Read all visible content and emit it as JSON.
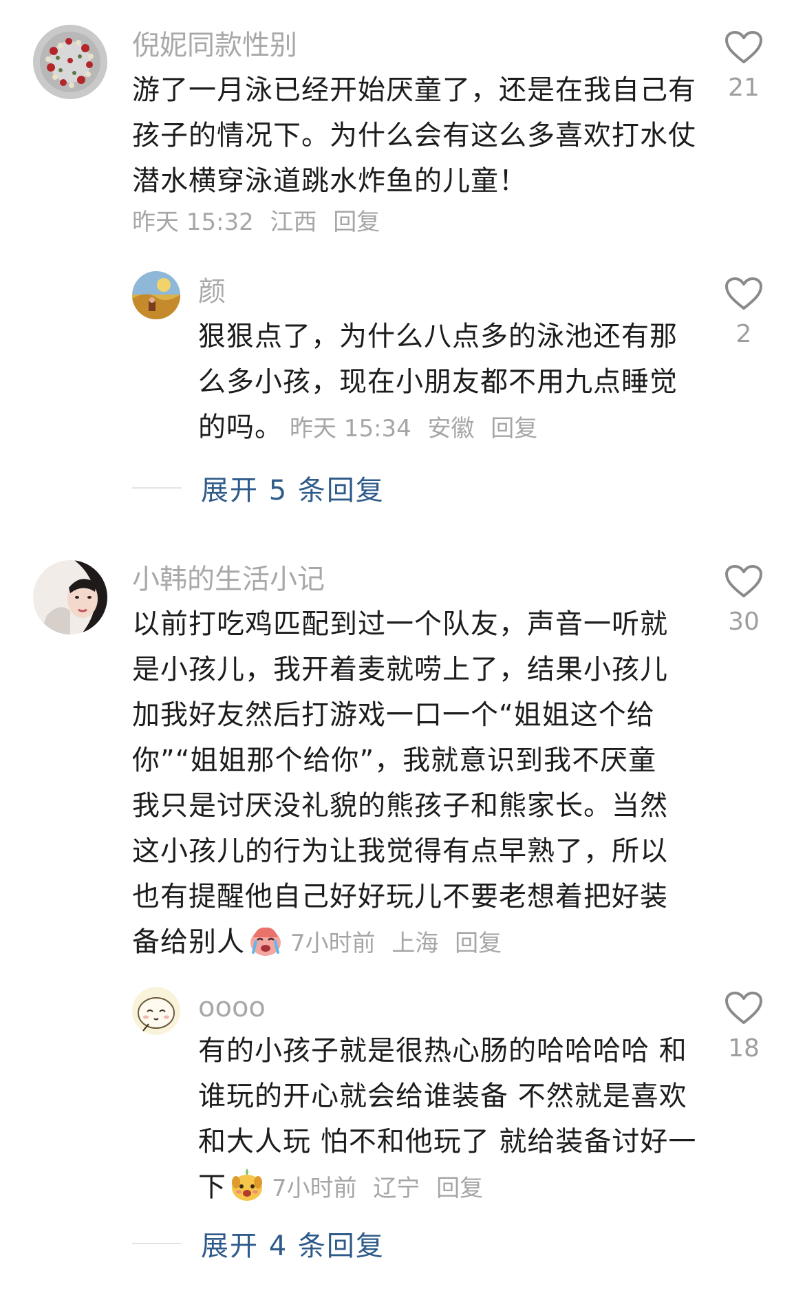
{
  "comments": [
    {
      "author": "倪妮同款性别",
      "text": "游了一月泳已经开始厌童了，还是在我自己有孩子的情况下。为什么会有这么多喜欢打水仗潜水横穿泳道跳水炸鱼的儿童！",
      "time": "昨天 15:32",
      "location": "江西",
      "reply_label": "回复",
      "likes": "21",
      "avatar_icon": "flower-wreath-avatar",
      "replies": [
        {
          "author": "颜",
          "text": "狠狠点了，为什么八点多的泳池还有那么多小孩，现在小朋友都不用九点睡觉的吗。",
          "time": "昨天 15:34",
          "location": "安徽",
          "reply_label": "回复",
          "likes": "2",
          "avatar_icon": "painting-landscape-avatar"
        }
      ],
      "expand_label": "展开 5 条回复"
    },
    {
      "author": "小韩的生活小记",
      "text": "以前打吃鸡匹配到过一个队友，声音一听就是小孩儿，我开着麦就唠上了，结果小孩儿加我好友然后打游戏一口一个“姐姐这个给你”“姐姐那个给你”，我就意识到我不厌童我只是讨厌没礼貌的熊孩子和熊家长。当然这小孩儿的行为让我觉得有点早熟了，所以也有提醒他自己好好玩儿不要老想着把好装备给别人",
      "emoji_icon": "crying-face-emoji",
      "time": "7小时前",
      "location": "上海",
      "reply_label": "回复",
      "likes": "30",
      "avatar_icon": "woman-portrait-avatar",
      "replies": [
        {
          "author": "oooo",
          "text": "有的小孩子就是很热心肠的哈哈哈哈 和谁玩的开心就会给谁装备 不然就是喜欢和大人玩 怕不和他玩了 就给装备讨好一下",
          "emoji_icon": "cute-dog-emoji",
          "time": "7小时前",
          "location": "辽宁",
          "reply_label": "回复",
          "likes": "18",
          "avatar_icon": "cartoon-face-avatar"
        }
      ],
      "expand_label": "展开 4 条回复"
    }
  ],
  "colors": {
    "author": "#a8a8a8",
    "text": "#1c1c1c",
    "meta": "#a6a6a6",
    "expand": "#2f5b8a",
    "heart": "#8a8a8a"
  }
}
